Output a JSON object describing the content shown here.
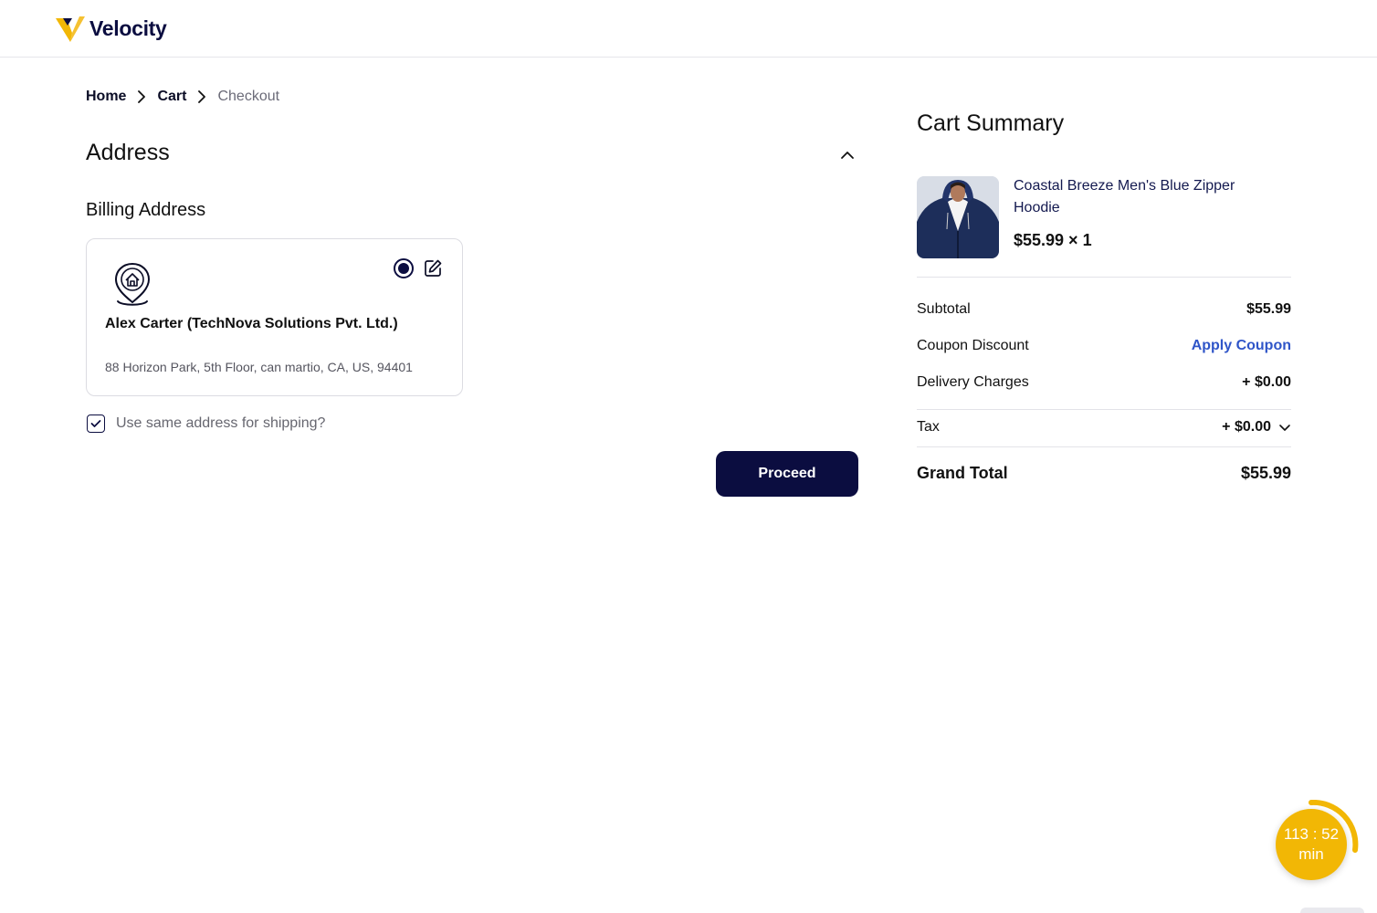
{
  "brand": {
    "name": "Velocity"
  },
  "breadcrumb": {
    "home": "Home",
    "cart": "Cart",
    "current": "Checkout"
  },
  "address": {
    "title": "Address",
    "billing_title": "Billing Address",
    "name": "Alex Carter (TechNova Solutions Pvt. Ltd.)",
    "line": "88 Horizon Park, 5th Floor, can martio, CA, US, 94401",
    "selected": true,
    "same_for_shipping_label": "Use same address for shipping?",
    "same_for_shipping_checked": true
  },
  "actions": {
    "proceed_label": "Proceed"
  },
  "summary": {
    "title": "Cart Summary",
    "item": {
      "name": "Coastal Breeze Men's Blue Zipper Hoodie",
      "price_qty": "$55.99 × 1"
    },
    "subtotal_label": "Subtotal",
    "subtotal_value": "$55.99",
    "coupon_label": "Coupon Discount",
    "coupon_action": "Apply Coupon",
    "delivery_label": "Delivery Charges",
    "delivery_value": "+ $0.00",
    "tax_label": "Tax",
    "tax_value": "+ $0.00",
    "grand_total_label": "Grand Total",
    "grand_total_value": "$55.99"
  },
  "timer": {
    "time": "113 : 52",
    "unit": "min"
  },
  "colors": {
    "primary": "#0b0d40",
    "accent": "#f2b705",
    "link": "#2f55c8"
  }
}
